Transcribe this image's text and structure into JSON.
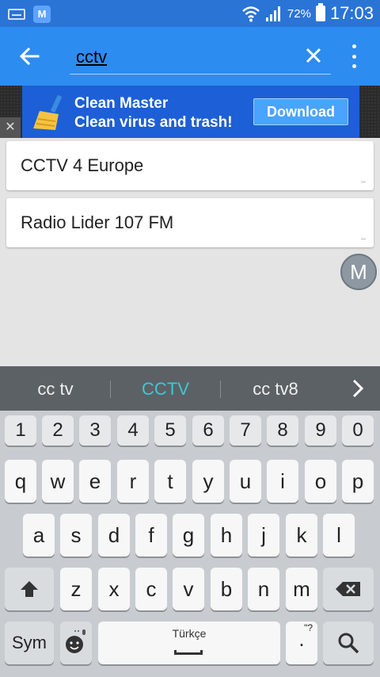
{
  "status_bar": {
    "battery": "72%",
    "time": "17:03",
    "app_badge": "M"
  },
  "toolbar": {
    "search_value": "cctv"
  },
  "ad": {
    "title": "Clean Master",
    "subtitle": "Clean virus and trash!",
    "button": "Download",
    "close": "✕"
  },
  "results": [
    {
      "title": "CCTV 4 Europe"
    },
    {
      "title": "Radio Lider 107 FM"
    }
  ],
  "fab": {
    "label": "M"
  },
  "keyboard": {
    "suggestions": [
      "cc tv",
      "CCTV",
      "cc tv8"
    ],
    "number_row": [
      "1",
      "2",
      "3",
      "4",
      "5",
      "6",
      "7",
      "8",
      "9",
      "0"
    ],
    "row1": [
      "q",
      "w",
      "e",
      "r",
      "t",
      "y",
      "u",
      "i",
      "o",
      "p"
    ],
    "row2": [
      "a",
      "s",
      "d",
      "f",
      "g",
      "h",
      "j",
      "k",
      "l"
    ],
    "row3": [
      "z",
      "x",
      "c",
      "v",
      "b",
      "n",
      "m"
    ],
    "sym": "Sym",
    "space": "Türkçe",
    "period": ".",
    "period_hint": "\"?"
  },
  "colors": {
    "status_bar": "#2a74d6",
    "toolbar": "#2d8cf0",
    "ad_bg": "#1d5fd6",
    "suggestion_active": "#3cc9d4"
  }
}
